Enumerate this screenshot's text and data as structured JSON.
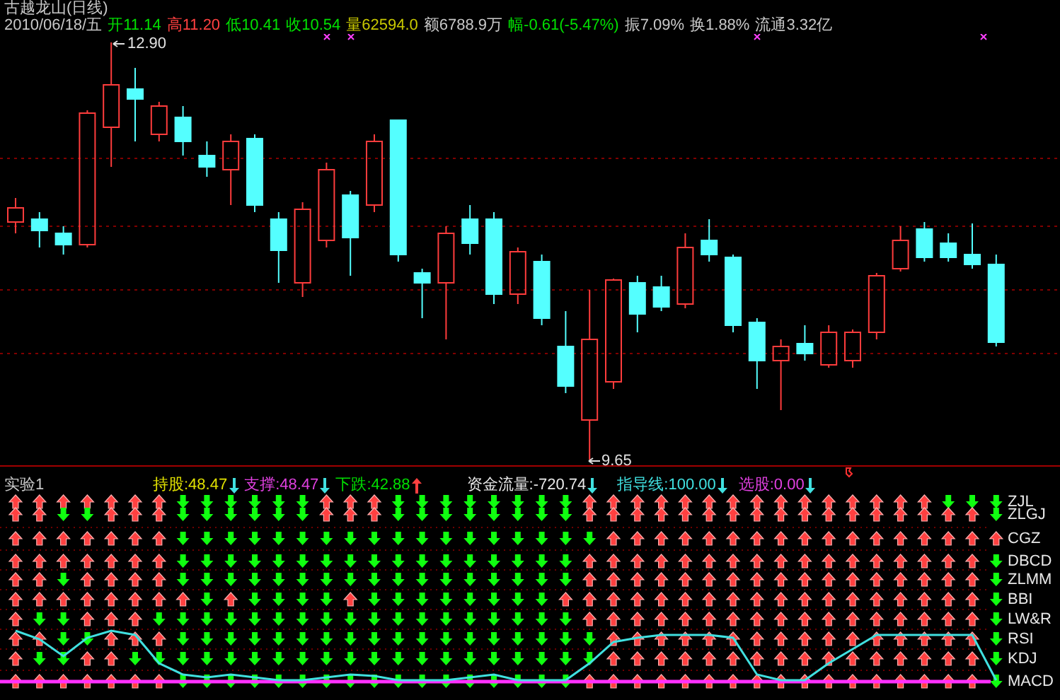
{
  "stock": {
    "title": "古越龙山(日线)"
  },
  "quote": [
    {
      "text": "2010/06/18/五",
      "color": "#c8c8c8"
    },
    {
      "text": "开11.14",
      "color": "#00e000"
    },
    {
      "text": "高11.20",
      "color": "#ff4040"
    },
    {
      "text": "低10.41",
      "color": "#00e000"
    },
    {
      "text": "收10.54",
      "color": "#00e000"
    },
    {
      "text": "量62594.0",
      "color": "#c8c800"
    },
    {
      "text": "额6788.9万",
      "color": "#c8c8c8"
    },
    {
      "text": "幅-0.61(-5.47%)",
      "color": "#00e000"
    },
    {
      "text": "振7.09%",
      "color": "#c8c8c8"
    },
    {
      "text": "换1.88%",
      "color": "#c8c8c8"
    },
    {
      "text": "流通3.32亿",
      "color": "#c8c8c8"
    }
  ],
  "price_chart": {
    "high_label": "12.90",
    "low_label": "9.65"
  },
  "indicator": {
    "title": "实验1",
    "values": [
      {
        "label": "持股:48.47",
        "color": "#e0e000",
        "rising": false
      },
      {
        "label": "支撑:48.47",
        "color": "#e040e0",
        "rising": false
      },
      {
        "label": "下跌:42.88",
        "color": "#00e000",
        "rising": true
      },
      {
        "label": "资金流量:-720.74",
        "color": "#e8e8e8",
        "rising": false
      },
      {
        "label": "指导线:100.00",
        "color": "#40e0e0",
        "rising": false
      },
      {
        "label": "选股:0.00",
        "color": "#e040e0",
        "rising": false
      }
    ],
    "rows": [
      {
        "name": "ZJL",
        "signals": [
          true,
          true,
          true,
          true,
          true,
          true,
          true,
          false,
          false,
          false,
          false,
          false,
          false,
          true,
          true,
          true,
          false,
          false,
          false,
          false,
          false,
          false,
          false,
          false,
          true,
          true,
          true,
          true,
          true,
          true,
          true,
          true,
          true,
          true,
          true,
          true,
          true,
          true,
          true,
          false,
          false,
          false
        ]
      },
      {
        "name": "ZLGJ",
        "signals": [
          true,
          true,
          false,
          false,
          true,
          true,
          true,
          false,
          false,
          false,
          false,
          false,
          false,
          true,
          true,
          true,
          false,
          false,
          false,
          false,
          false,
          false,
          false,
          false,
          true,
          true,
          true,
          true,
          true,
          true,
          true,
          true,
          true,
          true,
          true,
          true,
          true,
          true,
          true,
          true,
          true,
          false
        ]
      },
      {
        "name": "CGZ",
        "signals": [
          true,
          true,
          true,
          true,
          true,
          true,
          true,
          false,
          false,
          false,
          false,
          false,
          false,
          false,
          false,
          false,
          false,
          false,
          false,
          false,
          false,
          false,
          false,
          false,
          false,
          true,
          true,
          true,
          true,
          true,
          true,
          true,
          true,
          true,
          true,
          true,
          true,
          true,
          true,
          true,
          true,
          true
        ]
      },
      {
        "name": "DBCD",
        "signals": [
          true,
          true,
          true,
          true,
          true,
          true,
          true,
          false,
          false,
          false,
          false,
          false,
          false,
          false,
          false,
          false,
          false,
          false,
          false,
          false,
          false,
          false,
          false,
          false,
          true,
          true,
          true,
          true,
          true,
          true,
          true,
          true,
          true,
          true,
          true,
          true,
          true,
          true,
          true,
          true,
          true,
          false
        ]
      },
      {
        "name": "ZLMM",
        "signals": [
          true,
          true,
          false,
          true,
          true,
          true,
          true,
          false,
          false,
          false,
          false,
          false,
          false,
          false,
          false,
          false,
          false,
          false,
          false,
          false,
          false,
          false,
          false,
          false,
          true,
          true,
          true,
          true,
          true,
          true,
          true,
          true,
          true,
          true,
          true,
          true,
          true,
          true,
          true,
          true,
          true,
          false
        ]
      },
      {
        "name": "BBI",
        "signals": [
          true,
          true,
          true,
          true,
          true,
          true,
          true,
          true,
          false,
          true,
          false,
          false,
          false,
          false,
          true,
          false,
          false,
          false,
          false,
          false,
          false,
          false,
          false,
          true,
          true,
          true,
          true,
          true,
          true,
          true,
          true,
          true,
          true,
          true,
          true,
          true,
          true,
          true,
          true,
          true,
          true,
          false
        ]
      },
      {
        "name": "LW&R",
        "signals": [
          true,
          false,
          false,
          true,
          true,
          true,
          false,
          false,
          false,
          false,
          false,
          false,
          false,
          false,
          false,
          false,
          false,
          false,
          false,
          false,
          false,
          false,
          false,
          false,
          true,
          true,
          true,
          true,
          true,
          true,
          true,
          true,
          true,
          true,
          true,
          true,
          true,
          true,
          true,
          true,
          true,
          false
        ]
      },
      {
        "name": "RSI",
        "signals": [
          true,
          true,
          false,
          false,
          true,
          true,
          true,
          false,
          false,
          false,
          false,
          false,
          false,
          false,
          false,
          false,
          false,
          false,
          false,
          false,
          false,
          false,
          false,
          false,
          false,
          true,
          true,
          true,
          true,
          true,
          true,
          true,
          true,
          true,
          true,
          true,
          true,
          true,
          true,
          true,
          true,
          false
        ]
      },
      {
        "name": "KDJ",
        "signals": [
          true,
          false,
          false,
          true,
          true,
          false,
          false,
          false,
          false,
          false,
          false,
          false,
          false,
          false,
          false,
          false,
          false,
          false,
          false,
          false,
          false,
          false,
          false,
          false,
          false,
          true,
          true,
          true,
          true,
          true,
          true,
          true,
          true,
          true,
          true,
          true,
          true,
          true,
          true,
          true,
          true,
          false
        ]
      },
      {
        "name": "MACD",
        "signals": [
          true,
          true,
          true,
          true,
          true,
          true,
          true,
          false,
          false,
          false,
          false,
          false,
          false,
          false,
          false,
          false,
          false,
          false,
          false,
          false,
          false,
          false,
          false,
          false,
          true,
          true,
          true,
          true,
          true,
          true,
          true,
          true,
          true,
          true,
          true,
          true,
          true,
          true,
          true,
          true,
          true,
          false
        ]
      }
    ]
  }
}
